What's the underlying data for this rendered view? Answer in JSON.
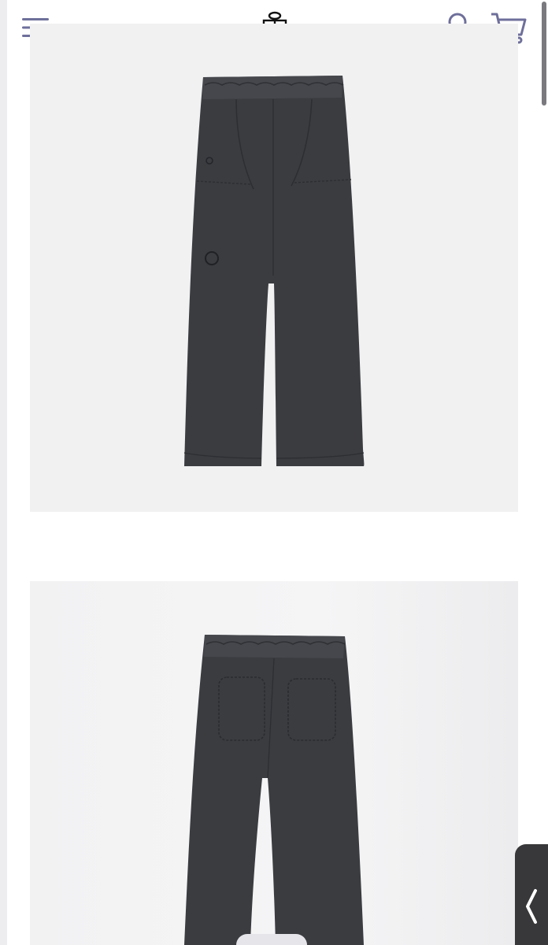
{
  "header": {
    "menu_icon": "hamburger-menu-icon",
    "logo_icon": "brand-logo-icon",
    "account_icon": "user-account-icon",
    "cart_icon": "shopping-cart-icon"
  },
  "gallery": {
    "images": [
      {
        "view": "front",
        "color": "#3a3c40"
      },
      {
        "view": "back",
        "color": "#3a3c40"
      }
    ]
  },
  "side_tab": {
    "icon": "chevron-left-icon"
  },
  "colors": {
    "accent_icons": "#6e6f9a",
    "card_background": "#f1f1f2",
    "garment": "#3a3c40"
  }
}
